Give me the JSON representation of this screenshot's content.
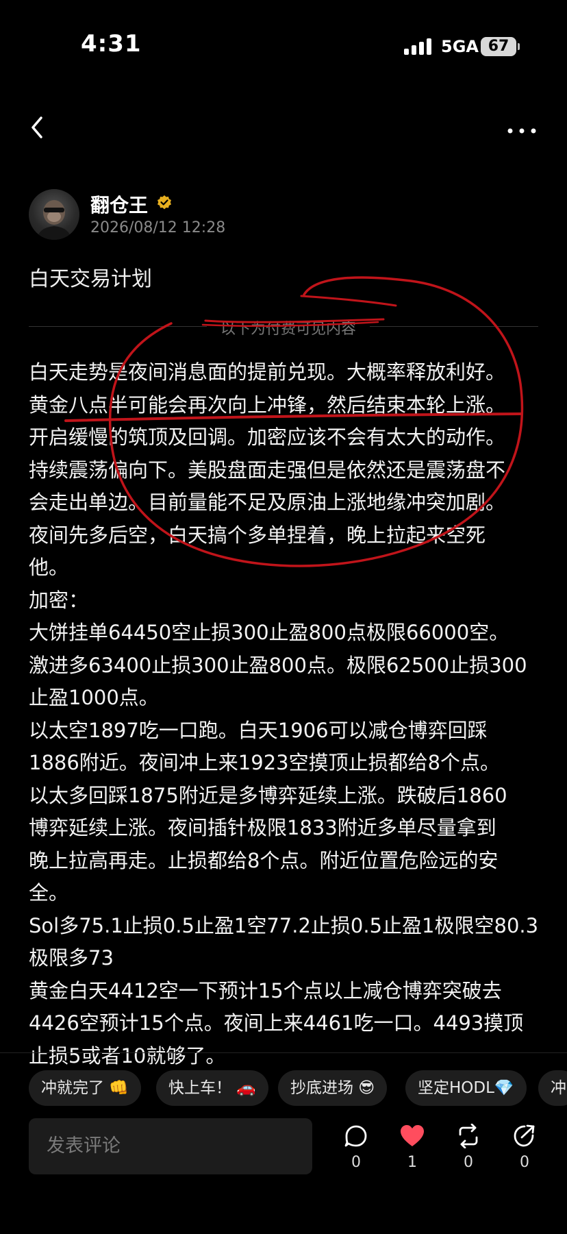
{
  "status_bar": {
    "time": "4:31",
    "network": "5GA",
    "battery": "67"
  },
  "author": {
    "name": "翻仓王",
    "date": "2026/08/12 12:28"
  },
  "post": {
    "title": "白天交易计划",
    "divider_text": "以下为付费可见内容",
    "lines": [
      "白天走势是夜间消息面的提前兑现。大概率释放利好。",
      "黄金八点半可能会再次向上冲锋，然后结束本轮上涨。",
      "开启缓慢的筑顶及回调。加密应该不会有太大的动作。",
      "持续震荡偏向下。美股盘面走强但是依然还是震荡盘不",
      "会走出单边。目前量能不足及原油上涨地缘冲突加剧。",
      "夜间先多后空，白天搞个多单捏着，晚上拉起来空死",
      "他。",
      "加密：",
      "大饼挂单64450空止损300止盈800点极限66000空。",
      "激进多63400止损300止盈800点。极限62500止损300",
      "止盈1000点。",
      "以太空1897吃一口跑。白天1906可以减仓博弈回踩",
      "1886附近。夜间冲上来1923空摸顶止损都给8个点。",
      "以太多回踩1875附近是多博弈延续上涨。跌破后1860",
      "博弈延续上涨。夜间插针极限1833附近多单尽量拿到",
      "晚上拉高再走。止损都给8个点。附近位置危险远的安",
      "全。",
      "Sol多75.1止损0.5止盈1空77.2止损0.5止盈1极限空80.3",
      "极限多73",
      "黄金白天4412空一下预计15个点以上减仓博弈突破去",
      "4426空预计15个点。夜间上来4461吃一口。4493摸顶",
      "止损5或者10就够了。"
    ]
  },
  "chips": [
    "冲就完了 👊",
    "快上车！ 🚗",
    "抄底进场 😎",
    "坚定HODL💎",
    "冲"
  ],
  "comment_placeholder": "发表评论",
  "actions": {
    "comment_count": "0",
    "like_count": "1",
    "repost_count": "0",
    "share_count": "0"
  },
  "colors": {
    "annotation_red": "#c0141a",
    "like_red": "#ff4d5e",
    "verified_gold": "#e8b020"
  }
}
